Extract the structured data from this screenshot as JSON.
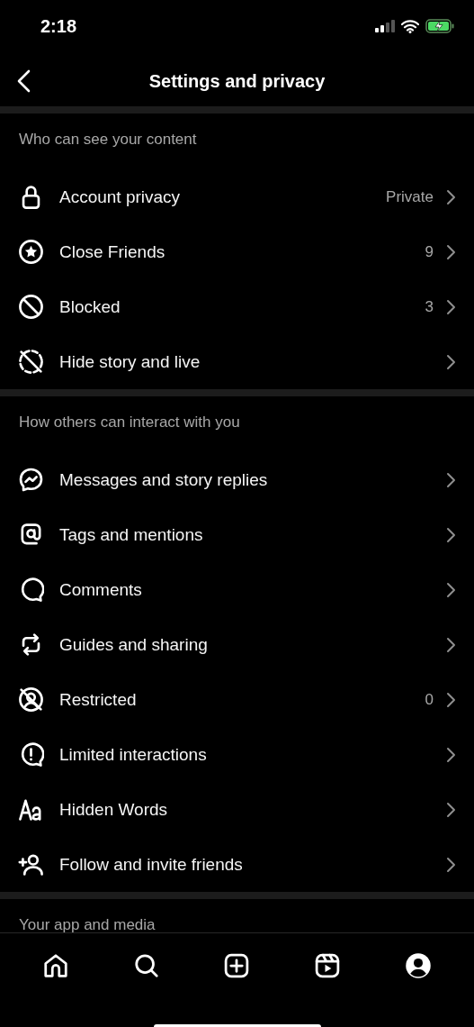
{
  "status_bar": {
    "time": "2:18"
  },
  "header": {
    "title": "Settings and privacy"
  },
  "sections": [
    {
      "title": "Who can see your content",
      "items": [
        {
          "label": "Account privacy",
          "value": "Private"
        },
        {
          "label": "Close Friends",
          "value": "9"
        },
        {
          "label": "Blocked",
          "value": "3"
        },
        {
          "label": "Hide story and live"
        }
      ]
    },
    {
      "title": "How others can interact with you",
      "items": [
        {
          "label": "Messages and story replies"
        },
        {
          "label": "Tags and mentions"
        },
        {
          "label": "Comments"
        },
        {
          "label": "Guides and sharing"
        },
        {
          "label": "Restricted",
          "value": "0"
        },
        {
          "label": "Limited interactions"
        },
        {
          "label": "Hidden Words"
        },
        {
          "label": "Follow and invite friends"
        }
      ]
    },
    {
      "title": "Your app and media"
    }
  ]
}
